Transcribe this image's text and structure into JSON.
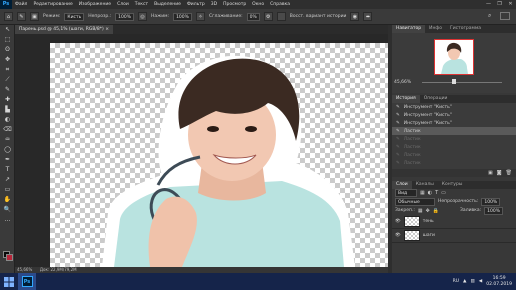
{
  "app": {
    "logo": "Ps"
  },
  "menu": [
    "Файл",
    "Редактирование",
    "Изображение",
    "Слои",
    "Текст",
    "Выделение",
    "Фильтр",
    "3D",
    "Просмотр",
    "Окно",
    "Справка"
  ],
  "window_controls": [
    "—",
    "❐",
    "✕"
  ],
  "options": {
    "mode_label": "Режим:",
    "mode_value": "Кисть",
    "opacity_label": "Непрозр.:",
    "opacity_value": "100%",
    "flow_label": "Нажим:",
    "flow_value": "100%",
    "smooth_label": "Сглаживание:",
    "smooth_value": "0%",
    "restore_label": "Восст. вариант истории"
  },
  "document": {
    "tab_title": "Парень.psd @ 45,1% (шаги, RGB/8*) ×",
    "zoom": "45,66%",
    "doc_size": "Док: 22,9M/79,2M"
  },
  "tools": [
    "↖",
    "⬚",
    "ʘ",
    "✥",
    "⌗",
    "⟋",
    "✎",
    "✚",
    "▙",
    "◐",
    "⌫",
    "♒",
    "◯",
    "✒",
    "T",
    "↗",
    "▭",
    "✋",
    "🔍",
    "…"
  ],
  "navigator": {
    "tabs": [
      "Навигатор",
      "Инфо",
      "Гистограмма"
    ],
    "zoom": "45,66%"
  },
  "history": {
    "tabs": [
      "История",
      "Операции"
    ],
    "items": [
      {
        "label": "Инструмент \"Кисть\"",
        "state": "normal"
      },
      {
        "label": "Инструмент \"Кисть\"",
        "state": "normal"
      },
      {
        "label": "Инструмент \"Кисть\"",
        "state": "normal"
      },
      {
        "label": "Ластик",
        "state": "selected"
      },
      {
        "label": "Ластик",
        "state": "dim"
      },
      {
        "label": "Ластик",
        "state": "dim"
      },
      {
        "label": "Ластик",
        "state": "dim"
      },
      {
        "label": "Ластик",
        "state": "dim"
      }
    ]
  },
  "layers": {
    "tabs": [
      "Слои",
      "Каналы",
      "Контуры"
    ],
    "filter": "Вид",
    "blend": "Обычные",
    "opacity_label": "Непрозрачность:",
    "opacity_value": "100%",
    "lock_label": "Закреп.:",
    "fill_label": "Заливка:",
    "fill_value": "100%",
    "items": [
      {
        "name": "тень"
      },
      {
        "name": "шаги"
      }
    ]
  },
  "taskbar": {
    "lang": "RU",
    "time": "16:59",
    "date": "02.07.2019"
  },
  "colors": {
    "accent": "#31a8ff",
    "taskbar": "#15244a",
    "panel": "#383838"
  }
}
